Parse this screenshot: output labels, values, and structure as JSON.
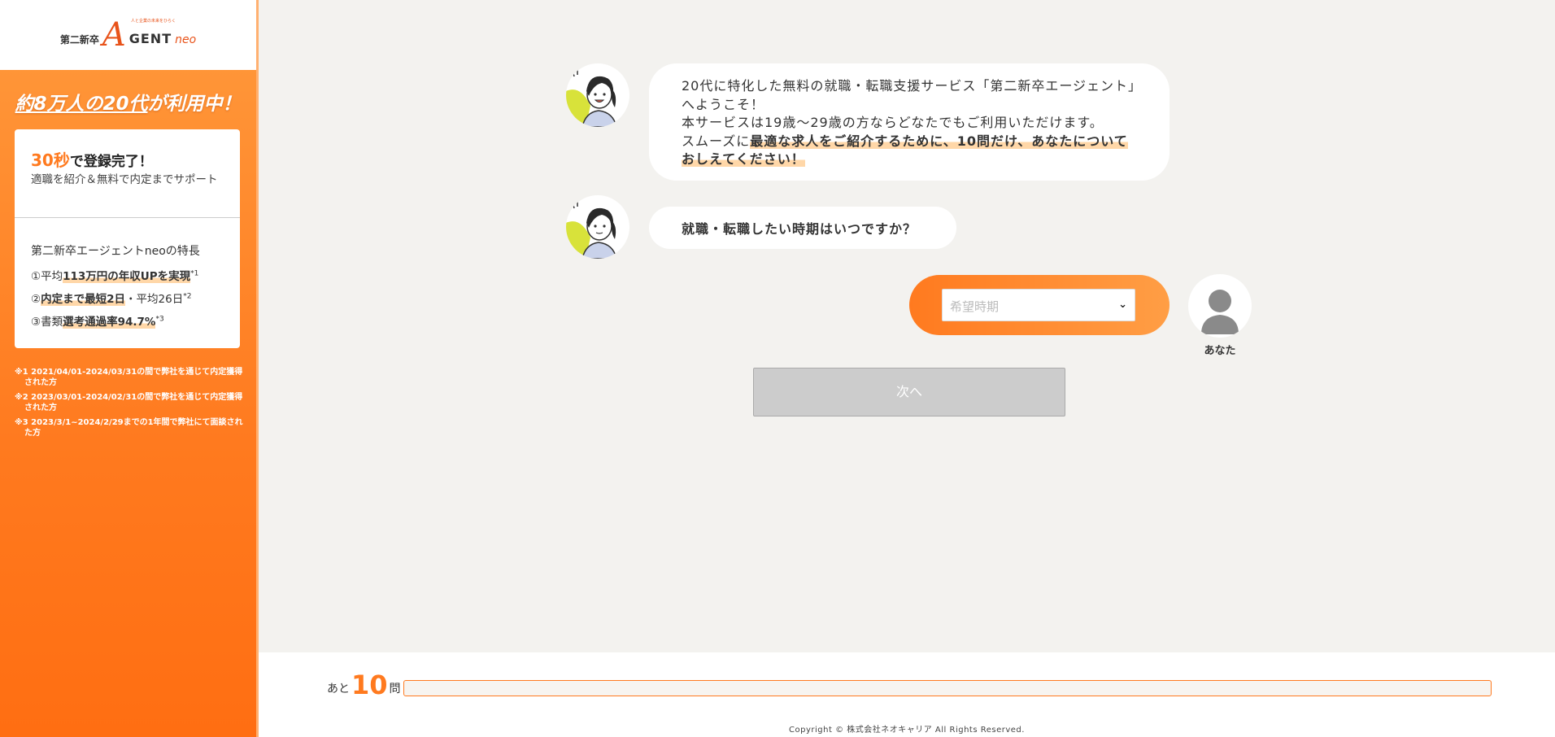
{
  "sidebar": {
    "logo": {
      "prefix": "第二新卒",
      "letter": "A",
      "gent": "GENT",
      "suffix": "neo",
      "tagline": "人と企業の未来をひらく"
    },
    "headline": {
      "part1": "約8万人の20代",
      "part2": "が利用中！"
    },
    "card": {
      "highlight": "30秒",
      "title_rest": "で登録完了！",
      "subtitle": "適職を紹介＆無料で内定までサポート",
      "features_title": "第二新卒エージェントneoの特長",
      "features": [
        {
          "pre": "①平均",
          "bold": "113万円の年収UPを実現",
          "post": "",
          "sup": "*1"
        },
        {
          "pre": "②",
          "bold": "内定まで最短2日",
          "post": "・平均26日",
          "sup": "*2"
        },
        {
          "pre": "③書類",
          "bold": "選考通過率94.7%",
          "post": "",
          "sup": "*3"
        }
      ]
    },
    "notes": [
      "※1 2021/04/01-2024/03/31の間で弊社を通じて内定獲得された方",
      "※2 2023/03/01-2024/02/31の間で弊社を通じて内定獲得された方",
      "※3 2023/3/1~2024/2/29までの1年間で弊社にて面談された方"
    ]
  },
  "chat": {
    "message1": {
      "line1": "20代に特化した無料の就職・転職支援サービス「第二新卒エージェント」へようこそ！",
      "line2": "本サービスは19歳〜29歳の方ならどなたでもご利用いただけます。",
      "line3_pre": "スムーズに",
      "line3_highlight": "最適な求人をご紹介するために、10問だけ、あなたについておしえてください！"
    },
    "message2": "就職・転職したい時期はいつですか？",
    "answer_select": {
      "placeholder": "希望時期"
    },
    "user_label": "あなた",
    "next_button": "次へ"
  },
  "footer": {
    "remaining_pre": "あと",
    "remaining_count": "10",
    "remaining_post": "問",
    "progress": 0,
    "copyright": "Copyright © 株式会社ネオキャリア All Rights Reserved."
  },
  "colors": {
    "accent": "#ff7a1f",
    "highlight": "#ffd7a8",
    "disabled": "#cccccc"
  },
  "icons": {
    "agent": "agent-avatar-icon",
    "user": "user-avatar-icon",
    "dropdown": "chevron-down-icon"
  }
}
